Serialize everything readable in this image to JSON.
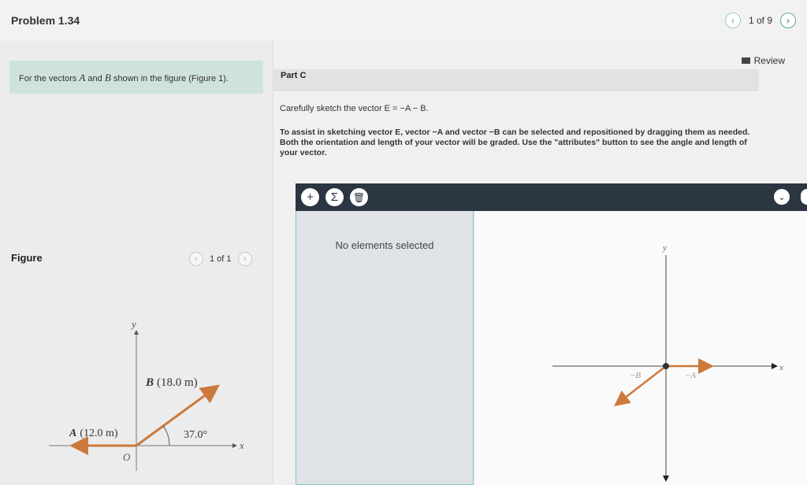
{
  "header": {
    "problem_title": "Problem 1.34",
    "pager_text": "1 of 9",
    "prev_glyph": "‹",
    "next_glyph": "›"
  },
  "left": {
    "prompt_prefix": "For the vectors ",
    "vec_a": "A",
    "and_text": " and ",
    "vec_b": "B",
    "prompt_suffix": " shown in the figure (Figure 1).",
    "figure_label": "Figure",
    "figure_pager": "1 of 1",
    "diagram": {
      "axis_y": "y",
      "axis_x": "x",
      "origin": "O",
      "label_b": "(18.0 m)",
      "label_a": "(12.0 m)",
      "angle": "37.0°"
    }
  },
  "right": {
    "review_label": "Review",
    "part_label": "Part C",
    "instruction_1": "Carefully sketch the vector E = −A − B.",
    "instruction_2": "To assist in sketching vector E, vector −A and vector −B can be selected and repositioned by dragging them as needed. Both the orientation and length of your vector will be graded. Use the \"attributes\" button to see the angle and length of your vector.",
    "no_elements": "No elements selected",
    "canvas": {
      "axis_y": "y",
      "axis_x": "x",
      "label_neg_a": "−A",
      "label_neg_b": "−B"
    }
  },
  "toolbar": {
    "add_glyph": "+",
    "sum_glyph": "Σ",
    "delete_glyph": "🗑",
    "dropdown_glyph": "⌄"
  },
  "colors": {
    "vector": "#cc7a3c",
    "toolbar": "#2c3542",
    "prompt_bg": "#cfe3dc"
  }
}
